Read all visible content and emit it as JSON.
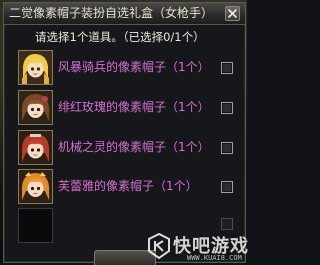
{
  "dialog": {
    "title": "二觉像素帽子装扮自选礼盒（女枪手）",
    "close_icon": "close-icon",
    "prompt": "请选择1个道具。（已选择0/1个）"
  },
  "items": [
    {
      "name": "风暴骑兵的像素帽子（1个）",
      "icon": "blonde-girl-pixel-hat-icon",
      "checked": false
    },
    {
      "name": "绯红玫瑰的像素帽子（1个）",
      "icon": "brown-hair-girl-pixel-hat-icon",
      "checked": false
    },
    {
      "name": "机械之灵的像素帽子（1个）",
      "icon": "red-hair-girl-pixel-hat-icon",
      "checked": false
    },
    {
      "name": "芙蕾雅的像素帽子（1个）",
      "icon": "orange-hair-girl-pixel-hat-icon",
      "checked": false
    }
  ],
  "colors": {
    "item_name": "#d66fd0",
    "title_text": "#e8e3cf",
    "panel_border": "#5d5a4c"
  },
  "watermark": {
    "text": "快吧游戏",
    "url": "WWW.KUAI8.COM"
  }
}
